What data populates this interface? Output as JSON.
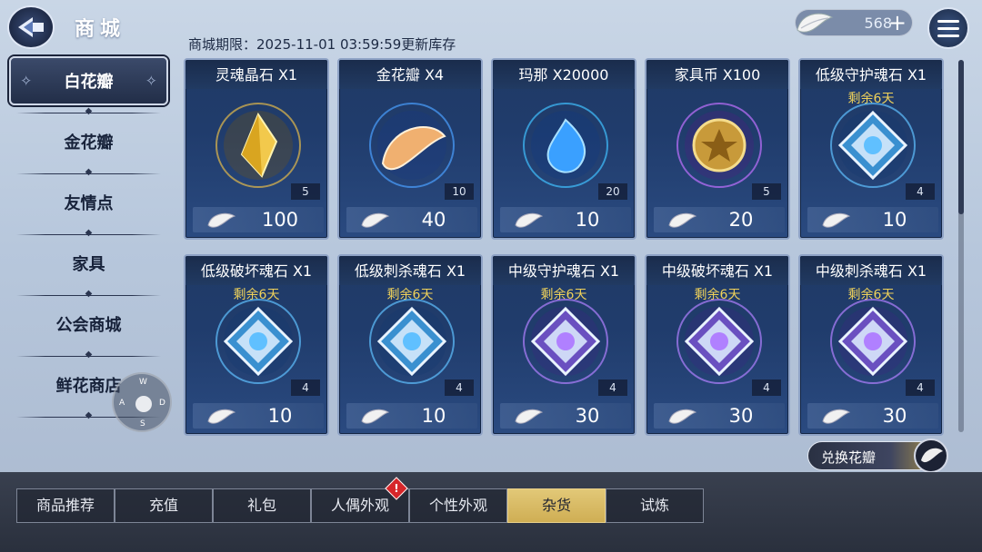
{
  "header": {
    "title": "商城",
    "refresh_notice": "商城期限：2025-11-01 03:59:59更新库存",
    "currency_amount": "568",
    "currency_plus": "+"
  },
  "side_nav": {
    "items": [
      {
        "label": "白花瓣",
        "active": true
      },
      {
        "label": "金花瓣"
      },
      {
        "label": "友情点"
      },
      {
        "label": "家具"
      },
      {
        "label": "公会商城"
      },
      {
        "label": "鲜花商店"
      }
    ]
  },
  "joystick": {
    "w": "W",
    "a": "A",
    "s": "S",
    "d": "D"
  },
  "products": [
    {
      "name": "灵魂晶石 X1",
      "timer": "",
      "stock": "5",
      "price": "100",
      "art": "gold-crystal-icon"
    },
    {
      "name": "金花瓣 X4",
      "timer": "",
      "stock": "10",
      "price": "40",
      "art": "golden-petal-icon"
    },
    {
      "name": "玛那 X20000",
      "timer": "",
      "stock": "20",
      "price": "10",
      "art": "blue-mana-icon"
    },
    {
      "name": "家具币 X100",
      "timer": "",
      "stock": "5",
      "price": "20",
      "art": "furniture-coin-icon"
    },
    {
      "name": "低级守护魂石 X1",
      "timer": "剩余6天",
      "stock": "4",
      "price": "10",
      "art": "guard-soulstone-icon"
    },
    {
      "name": "低级破坏魂石 X1",
      "timer": "剩余6天",
      "stock": "4",
      "price": "10",
      "art": "destroy-soulstone-icon"
    },
    {
      "name": "低级刺杀魂石 X1",
      "timer": "剩余6天",
      "stock": "4",
      "price": "10",
      "art": "assassin-soulstone-icon"
    },
    {
      "name": "中级守护魂石 X1",
      "timer": "剩余6天",
      "stock": "4",
      "price": "30",
      "art": "mid-guard-soulstone-icon"
    },
    {
      "name": "中级破坏魂石 X1",
      "timer": "剩余6天",
      "stock": "4",
      "price": "30",
      "art": "mid-destroy-soulstone-icon"
    },
    {
      "name": "中级刺杀魂石 X1",
      "timer": "剩余6天",
      "stock": "4",
      "price": "30",
      "art": "mid-assassin-soulstone-icon"
    }
  ],
  "exchange_button": "兑换花瓣",
  "bottom_tabs": [
    {
      "label": "商品推荐"
    },
    {
      "label": "充值"
    },
    {
      "label": "礼包"
    },
    {
      "label": "人偶外观",
      "badge": "!"
    },
    {
      "label": "个性外观"
    },
    {
      "label": "杂货",
      "active": true
    },
    {
      "label": "试炼"
    }
  ],
  "colors": {
    "accent_gold": "#e2c878",
    "timer_text": "#f0d25a",
    "card_bg": "#203c6c"
  }
}
